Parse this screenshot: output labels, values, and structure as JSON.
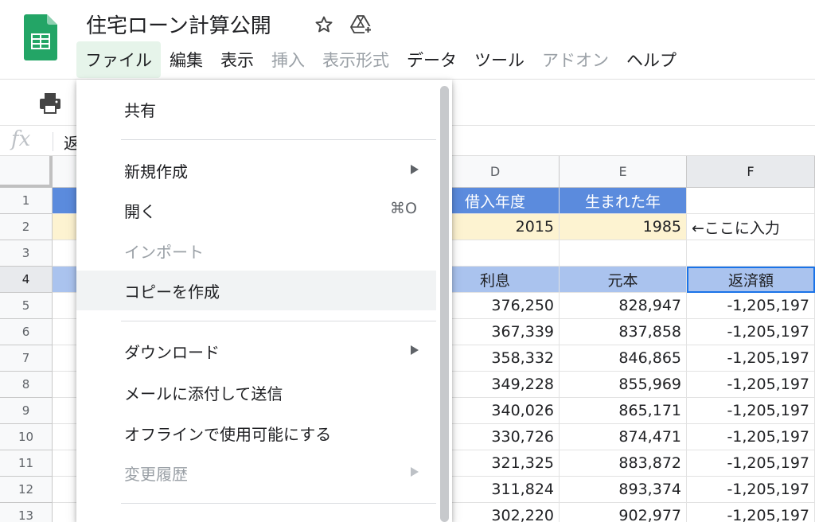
{
  "header": {
    "title": "住宅ローン計算公開",
    "menus": [
      {
        "label": "ファイル",
        "state": "active"
      },
      {
        "label": "編集",
        "state": "normal"
      },
      {
        "label": "表示",
        "state": "normal"
      },
      {
        "label": "挿入",
        "state": "disabled"
      },
      {
        "label": "表示形式",
        "state": "disabled"
      },
      {
        "label": "データ",
        "state": "normal"
      },
      {
        "label": "ツール",
        "state": "normal"
      },
      {
        "label": "アドオン",
        "state": "disabled"
      },
      {
        "label": "ヘルプ",
        "state": "normal"
      }
    ]
  },
  "icons": {
    "logo": "google-sheets-logo-icon",
    "star": "star-icon",
    "drive": "drive-add-icon",
    "print": "print-icon"
  },
  "formula_bar": {
    "fx": "fx",
    "content": "返"
  },
  "grid": {
    "columns": [
      "D",
      "E",
      "F"
    ],
    "row_numbers": [
      "1",
      "2",
      "3",
      "4",
      "5",
      "6",
      "7",
      "8",
      "9",
      "10",
      "11",
      "12",
      "13"
    ],
    "rows": [
      [
        "借入年度",
        "生まれた年",
        ""
      ],
      [
        "2015",
        "1985",
        "←ここに入力"
      ],
      [
        "",
        "",
        ""
      ],
      [
        "利息",
        "元本",
        "返済額"
      ],
      [
        "376,250",
        "828,947",
        "-1,205,197"
      ],
      [
        "367,339",
        "837,858",
        "-1,205,197"
      ],
      [
        "358,332",
        "846,865",
        "-1,205,197"
      ],
      [
        "349,228",
        "855,969",
        "-1,205,197"
      ],
      [
        "340,026",
        "865,171",
        "-1,205,197"
      ],
      [
        "330,726",
        "874,471",
        "-1,205,197"
      ],
      [
        "321,325",
        "883,872",
        "-1,205,197"
      ],
      [
        "311,824",
        "893,374",
        "-1,205,197"
      ],
      [
        "302,220",
        "902,977",
        "-1,205,197"
      ]
    ]
  },
  "file_menu": {
    "items": [
      {
        "label": "共有",
        "disabled": false
      },
      {
        "label": "新規作成",
        "disabled": false,
        "submenu": true
      },
      {
        "label": "開く",
        "disabled": false,
        "shortcut": "⌘O"
      },
      {
        "label": "インポート",
        "disabled": true
      },
      {
        "label": "コピーを作成",
        "disabled": false,
        "hovered": true
      },
      {
        "label": "ダウンロード",
        "disabled": false,
        "submenu": true
      },
      {
        "label": "メールに添付して送信",
        "disabled": false
      },
      {
        "label": "オフラインで使用可能にする",
        "disabled": false
      },
      {
        "label": "変更履歴",
        "disabled": true,
        "submenu": true
      }
    ]
  },
  "colors": {
    "header_blue": "#5b8bdd",
    "input_yellow": "#fdf3d1",
    "table_header_lightblue": "#aac3ee",
    "selection": "#1a73e8",
    "sheets_green": "#0f9d58"
  }
}
